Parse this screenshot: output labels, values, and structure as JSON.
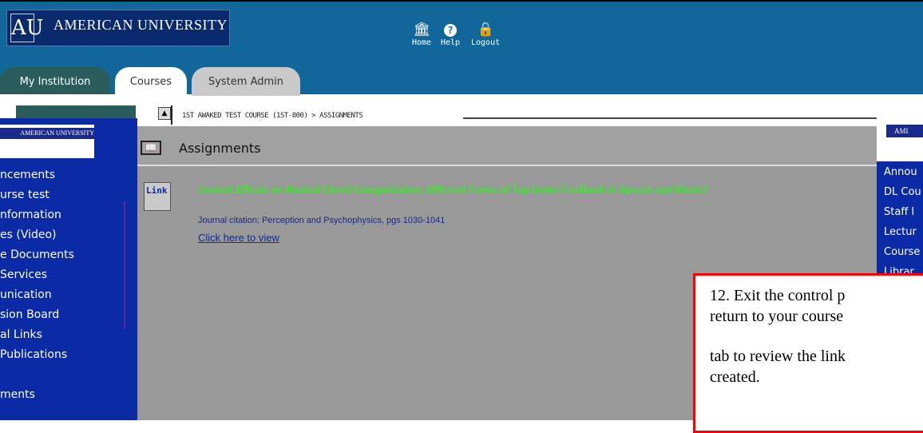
{
  "header": {
    "brand": "AMERICAN UNIVERSITY",
    "logo_mark": "AU",
    "nav": [
      {
        "label": "Home",
        "icon": "home-icon"
      },
      {
        "label": "Help",
        "icon": "help-icon"
      },
      {
        "label": "Logout",
        "icon": "lock-icon"
      }
    ]
  },
  "tabs": [
    {
      "label": "My Institution",
      "active": false
    },
    {
      "label": "Courses",
      "active": true
    },
    {
      "label": "System Admin",
      "active": false
    }
  ],
  "breadcrumb": "1ST AWAKED TEST COURSE (1ST-800) > ASSIGNMENTS",
  "left_menu": [
    "ncements",
    "urse test",
    "nformation",
    "es (Video)",
    "e Documents",
    " Services",
    "unication",
    "sion Board",
    "al Links",
    "Publications",
    "",
    "ments"
  ],
  "content": {
    "title": "Assignments",
    "item": {
      "icon_label": "Link",
      "title": "Context Effects on Musical Chord Categorization: Different Forms of Top-Down Feedback in Speech and Music?",
      "description": "Journal citation: Perception and Psychophysics, pgs 1030-1041",
      "link": "Click here to view"
    }
  },
  "right_menu": [
    "Annou",
    "DL Cou",
    "Staff I",
    "Lectur",
    "Course",
    "Librar"
  ],
  "callout": {
    "line1": "12. Exit the control p",
    "line2": "return to your course",
    "line3": "tab to review the link",
    "line4": "created."
  },
  "colors": {
    "header_bg": "#12679a",
    "panel_blue": "#0a2aa6",
    "content_gray": "#999999",
    "item_title_green": "#33ee22",
    "callout_border": "#ff0000"
  }
}
